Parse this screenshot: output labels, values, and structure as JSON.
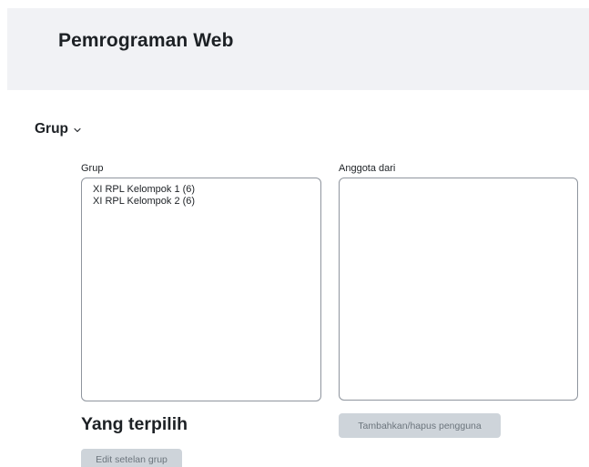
{
  "header": {
    "course_title": "Pemrograman Web"
  },
  "section": {
    "title": "Grup",
    "toggle_icon": "chevron-down-icon"
  },
  "groups": {
    "label": "Grup",
    "items": [
      "XI RPL Kelompok 1 (6)",
      "XI RPL Kelompok 2 (6)"
    ]
  },
  "members": {
    "label": "Anggota dari",
    "items": []
  },
  "actions": {
    "add_remove_users": "Tambahkan/hapus pengguna",
    "edit_group_settings": "Edit setelan grup"
  },
  "selected": {
    "heading": "Yang terpilih"
  },
  "colors": {
    "header_bg": "#f1f2f5",
    "border": "#8f959e",
    "button_bg": "#ced4da",
    "button_text": "#6c757d",
    "text": "#1d2125"
  }
}
